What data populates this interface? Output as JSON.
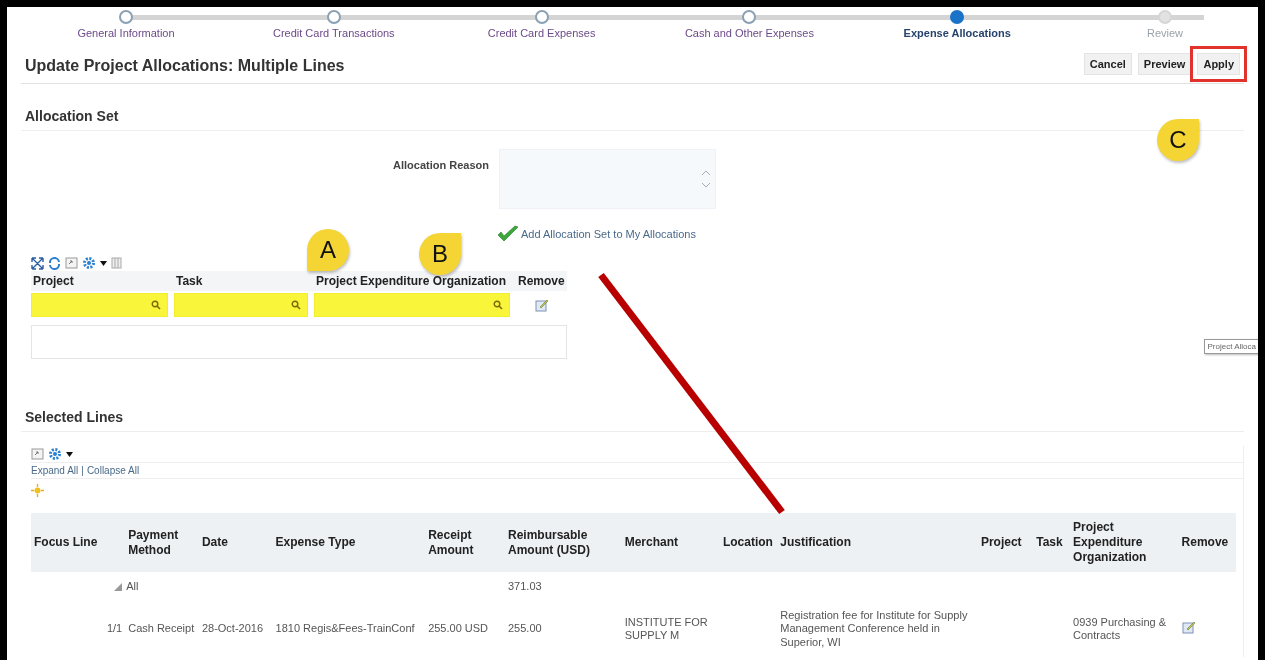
{
  "steps": [
    {
      "label": "General Information",
      "selected": false,
      "disabled": false
    },
    {
      "label": "Credit Card Transactions",
      "selected": false,
      "disabled": false
    },
    {
      "label": "Credit Card Expenses",
      "selected": false,
      "disabled": false
    },
    {
      "label": "Cash and Other Expenses",
      "selected": false,
      "disabled": false
    },
    {
      "label": "Expense Allocations",
      "selected": true,
      "disabled": false
    },
    {
      "label": "Review",
      "selected": false,
      "disabled": true
    }
  ],
  "title": "Update Project Allocations: Multiple Lines",
  "buttons": [
    {
      "label": "Cancel",
      "highlighted": false
    },
    {
      "label": "Preview",
      "highlighted": false
    },
    {
      "label": "Apply",
      "highlighted": true
    }
  ],
  "callouts": [
    {
      "label": "A"
    },
    {
      "label": "B"
    },
    {
      "label": "C"
    }
  ],
  "allocation_set": {
    "heading": "Allocation Set",
    "reason_label": "Allocation Reason",
    "add_link": "Add Allocation Set to My Allocations",
    "columns": [
      "Project",
      "Task",
      "Project Expenditure Organization",
      "Remove"
    ],
    "fields": [
      {
        "highlighted": true
      },
      {
        "highlighted": true
      },
      {
        "highlighted": true
      }
    ]
  },
  "tooltip": "Project Alloca",
  "selected_lines": {
    "heading": "Selected Lines",
    "links": [
      "Expand All",
      "Collapse All"
    ],
    "separator": "|",
    "columns": [
      "Focus Line",
      "Payment Method",
      "Date",
      "Expense Type",
      "Receipt Amount",
      "Reimbursable Amount (USD)",
      "Merchant",
      "Location",
      "Justification",
      "Project",
      "Task",
      "Project Expenditure Organization",
      "Remove"
    ],
    "rows": [
      {
        "kind": "group",
        "expanded": true,
        "label": "All",
        "amount": "371.03"
      },
      {
        "kind": "line",
        "focus": "1/1",
        "payment": "Cash Receipt",
        "date": "28-Oct-2016",
        "expense_type": "1810 Regis&Fees-TrainConf",
        "receipt_amount": "255.00 USD",
        "reimbursable": "255.00",
        "merchant": "INSTITUTE FOR SUPPLY M",
        "justification": "Registration fee for Institute for Supply Management Conference held in Superior, WI",
        "organization": "0939 Purchasing & Contracts"
      }
    ]
  }
}
